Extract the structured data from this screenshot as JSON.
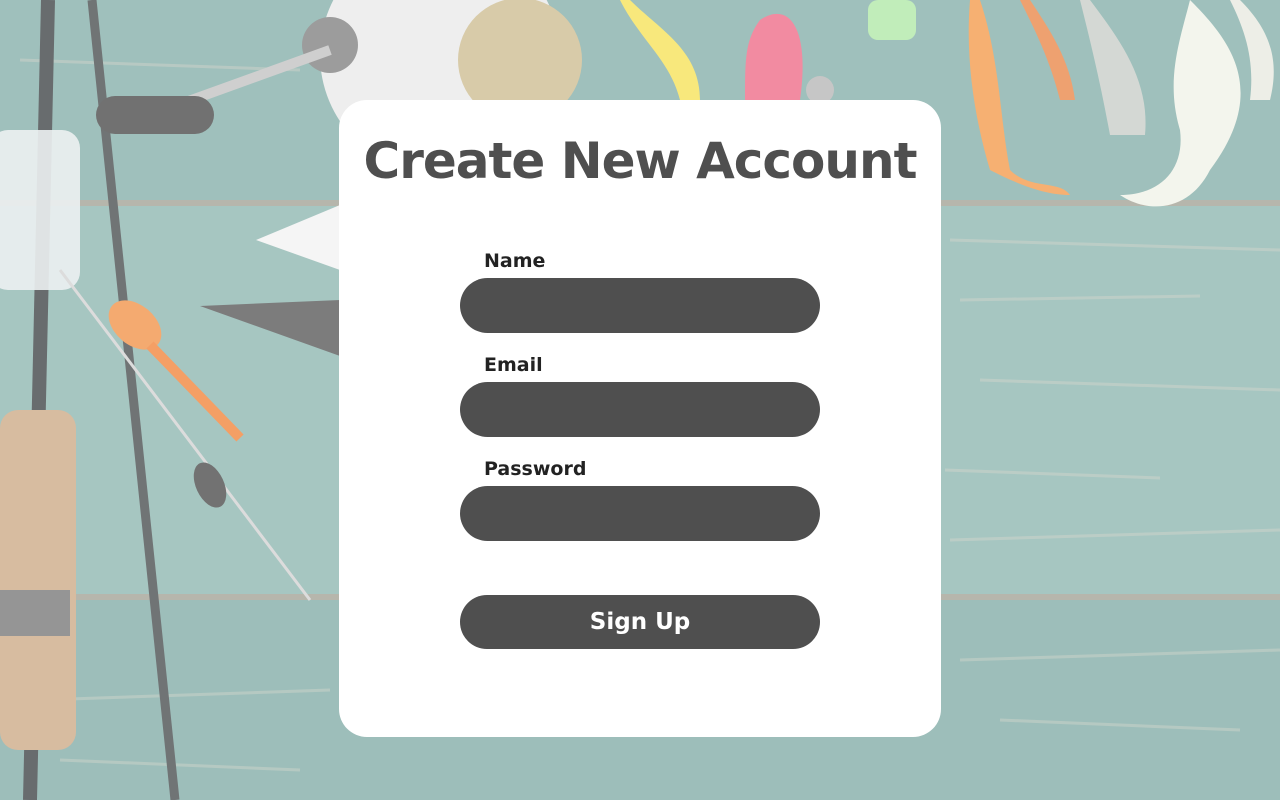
{
  "form": {
    "title": "Create New Account",
    "fields": [
      {
        "label": "Name",
        "value": "",
        "placeholder": ""
      },
      {
        "label": "Email",
        "value": "",
        "placeholder": ""
      },
      {
        "label": "Password",
        "value": "",
        "placeholder": ""
      }
    ],
    "submit_label": "Sign Up"
  },
  "colors": {
    "card": "#ffffff",
    "input": "#4f4f4f",
    "button": "#4f4f4f",
    "title": "#4f4f4f",
    "label": "#222222",
    "wood": "#6b9a95"
  }
}
